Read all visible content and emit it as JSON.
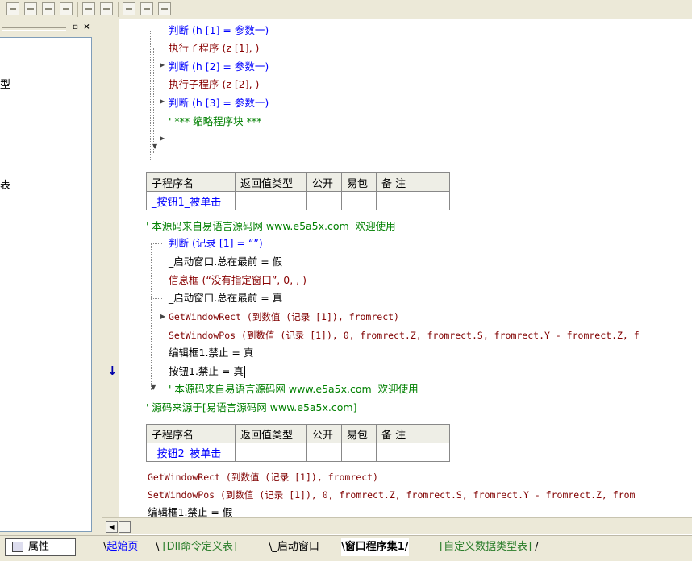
{
  "left_panel": {
    "fragments": [
      "型",
      "表"
    ]
  },
  "gutter": {
    "marker_double_arrow": "»",
    "marker_down": "↓",
    "marker_plus": "+"
  },
  "block1": {
    "lines": [
      {
        "a": "判断 (h [1] = 参数一)"
      },
      {
        "a": "执行子程序 (z [1], )"
      },
      {
        "a": "判断 (h [2] = 参数一)"
      },
      {
        "a": "执行子程序 (z [2], )"
      },
      {
        "a": "判断 (h [3] = 参数一)"
      },
      {
        "a": "' *** 缩略程序块 ***"
      }
    ]
  },
  "table_headers": [
    "子程序名",
    "返回值类型",
    "公开",
    "易包",
    "备 注"
  ],
  "sub1": {
    "name": "_按钮1_被单击",
    "comment": "' 本源码来自易语言源码网 www.e5a5x.com  欢迎使用",
    "l1": "判断 (记录 [1] = “”)",
    "l2": "_启动窗口.总在最前 = 假",
    "l3": "信息框 (“没有指定窗口”, 0, , )",
    "l4": "_启动窗口.总在最前 = 真",
    "l5": "GetWindowRect (到数值 (记录 [1]), fromrect)",
    "l6": "SetWindowPos (到数值 (记录 [1]), 0, fromrect.Z, fromrect.S, fromrect.Y - fromrect.Z, f",
    "l7": "编辑框1.禁止 = 真",
    "l8": "按钮1.禁止 = 真",
    "l9": "' 本源码来自易语言源码网 www.e5a5x.com  欢迎使用",
    "l10": "' 源码来源于[易语言源码网 www.e5a5x.com]"
  },
  "sub2": {
    "name": "_按钮2_被单击",
    "l1": "GetWindowRect (到数值 (记录 [1]), fromrect)",
    "l2": "SetWindowPos (到数值 (记录 [1]), 0, fromrect.Z, fromrect.S, fromrect.Y - fromrect.Z, from",
    "l3": "编辑框1.禁止 = 假"
  },
  "bottom": {
    "properties_tab": "属性",
    "tabs": [
      "起始页",
      "[Dll命令定义表]",
      "_启动窗口",
      "窗口程序集1",
      "[自定义数据类型表]"
    ],
    "active_tab": "窗口程序集1"
  }
}
